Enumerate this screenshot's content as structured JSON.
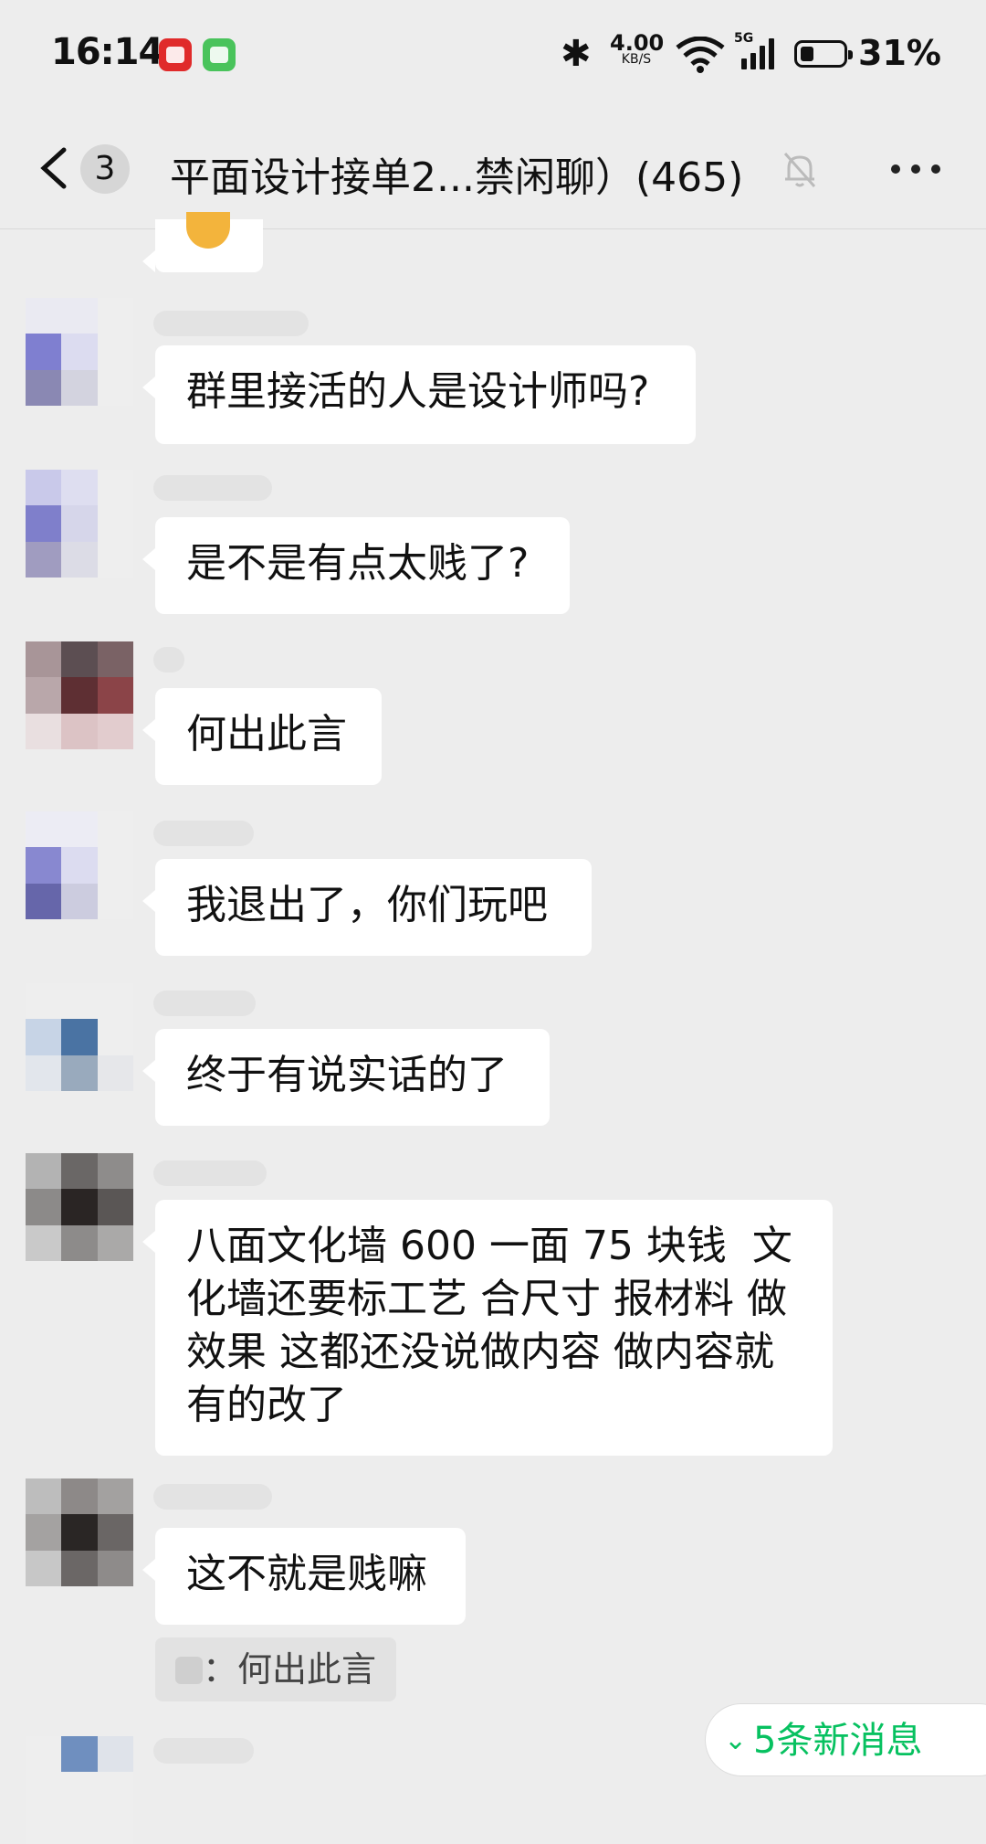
{
  "status_bar": {
    "time": "16:14",
    "speed_value": "4.00",
    "speed_unit": "KB/S",
    "network": "5G",
    "battery": "31%"
  },
  "header": {
    "unread_count": "3",
    "title": "平面设计接单2...禁闲聊）(465)"
  },
  "messages": [
    {
      "text": "群里接活的人是设计师吗?"
    },
    {
      "text": "是不是有点太贱了?"
    },
    {
      "text": "何出此言"
    },
    {
      "text": "我退出了，你们玩吧"
    },
    {
      "text": "终于有说实话的了"
    },
    {
      "text": "八面文化墙 600 一面 75 块钱  文\n化墙还要标工艺 合尺寸 报材料 做\n效果 这都还没说做内容 做内容就\n有的改了"
    },
    {
      "text": "这不就是贱嘛"
    }
  ],
  "quote": {
    "text": "：何出此言"
  },
  "new_messages_pill": {
    "text": "5条新消息"
  },
  "colors": {
    "background": "#ededed",
    "bubble": "#ffffff",
    "accent": "#07c160"
  },
  "icons": [
    "back-chevron-icon",
    "mute-bell-icon",
    "more-icon",
    "bluetooth-icon",
    "wifi-icon",
    "signal-icon",
    "battery-icon"
  ]
}
